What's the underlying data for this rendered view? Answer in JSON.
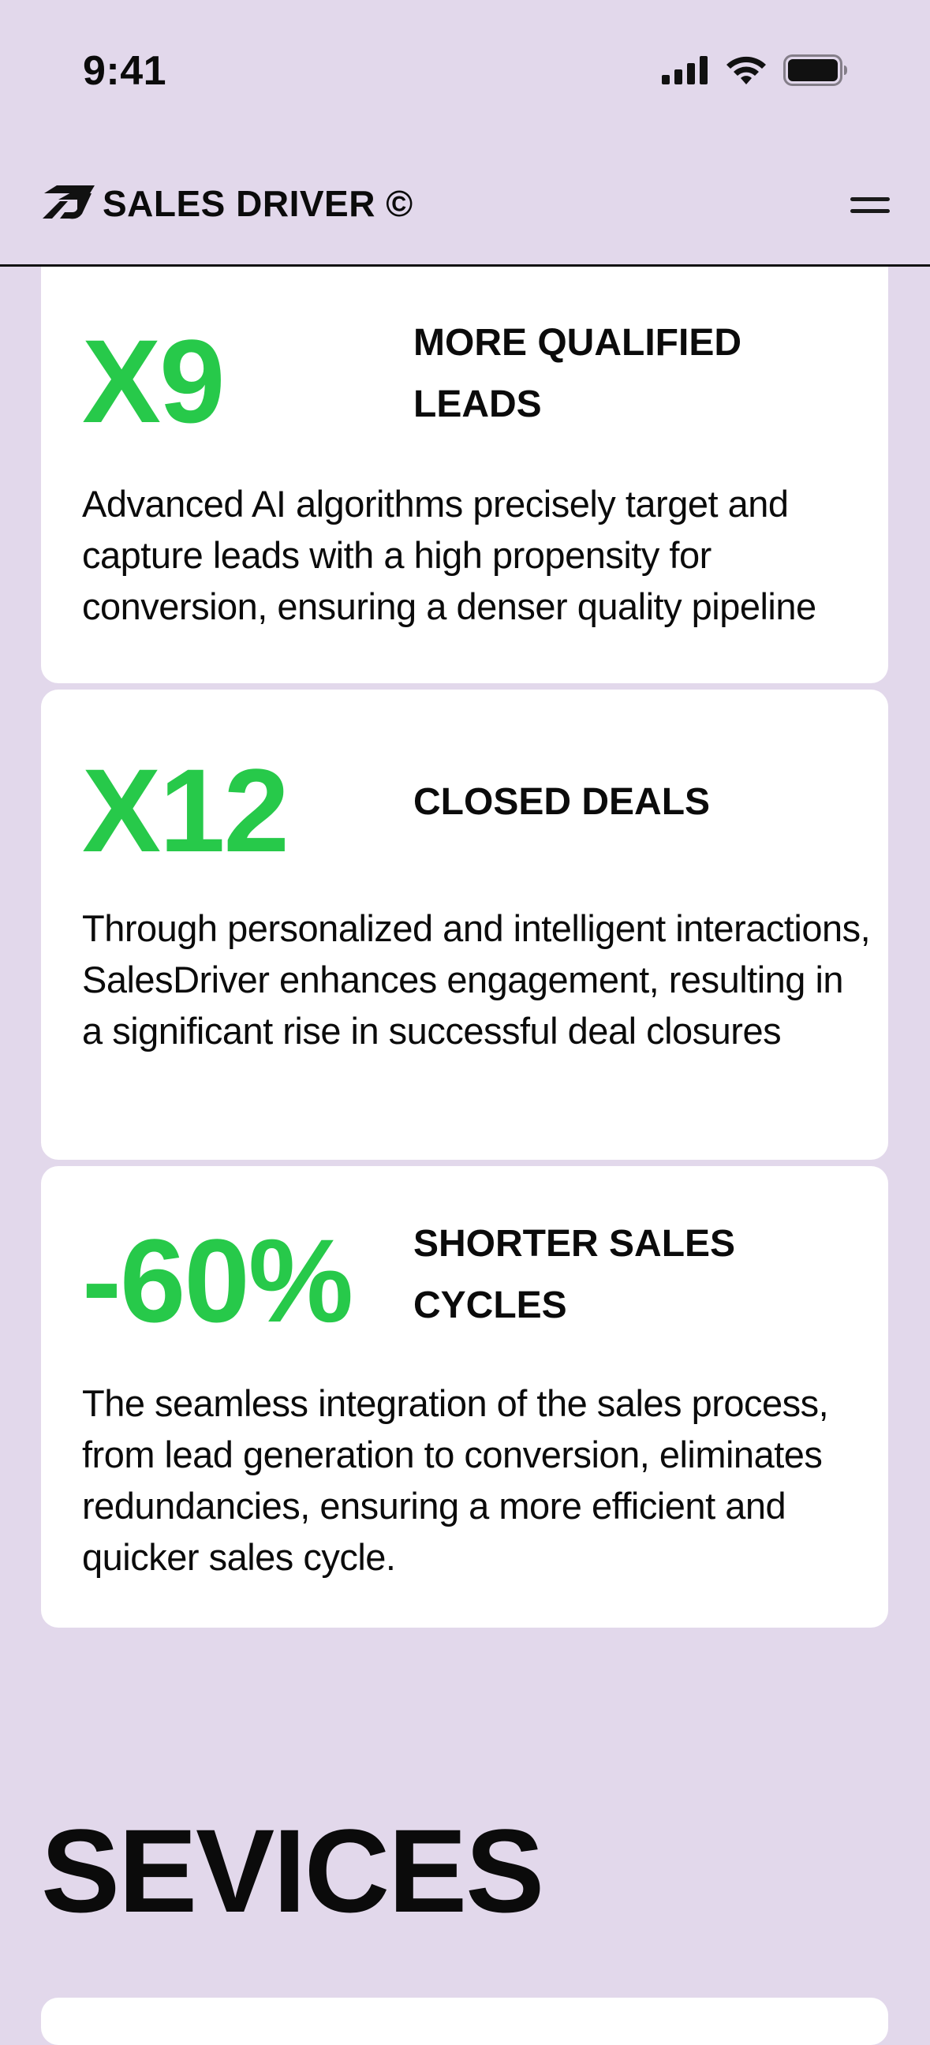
{
  "status_bar": {
    "time": "9:41",
    "icons": [
      "cellular-signal-icon",
      "wifi-icon",
      "battery-icon"
    ]
  },
  "header": {
    "brand_name": "SALES DRIVER ©",
    "logo_icon": "sales-driver-logo-icon",
    "menu_icon": "hamburger-menu-icon"
  },
  "stats": [
    {
      "value": "X9",
      "label": "MORE QUALIFIED LEADS",
      "description": "Advanced AI algorithms precisely target and capture leads with a high propensity for conversion, ensuring a denser quality pipeline"
    },
    {
      "value": "X12",
      "label": "CLOSED DEALS",
      "description": "Through personalized and intelligent interactions, SalesDriver enhances engagement, resulting in a significant rise in successful deal closures"
    },
    {
      "value": "-60%",
      "label": "SHORTER SALES CYCLES",
      "description": "The seamless integration of the sales process, from lead generation to conversion, eliminates redundancies, ensuring a more efficient and quicker sales cycle."
    }
  ],
  "services": {
    "title": "SEVICES"
  },
  "colors": {
    "background": "#e2d8eb",
    "card": "#ffffff",
    "accent_green": "#27c94a",
    "text": "#0b0b0b"
  }
}
